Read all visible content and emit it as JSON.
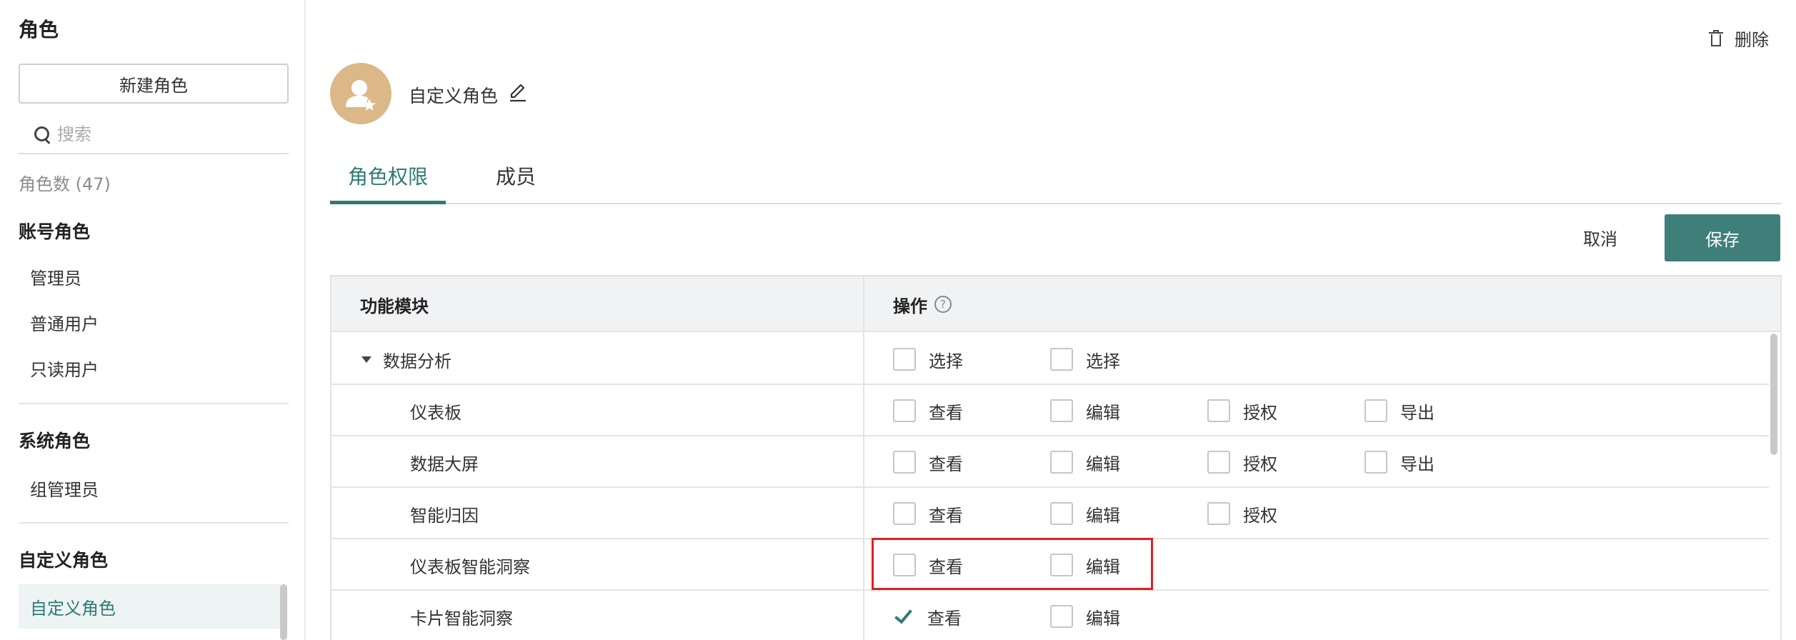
{
  "sidebar": {
    "title": "角色",
    "new_role_button": "新建角色",
    "search_placeholder": "搜索",
    "role_count": "角色数 (47)",
    "groups": [
      {
        "title": "账号角色",
        "items": [
          "管理员",
          "普通用户",
          "只读用户"
        ]
      },
      {
        "title": "系统角色",
        "items": [
          "组管理员"
        ]
      },
      {
        "title": "自定义角色",
        "items": [
          "自定义角色"
        ]
      }
    ],
    "active_item": "自定义角色"
  },
  "header": {
    "delete_label": "删除",
    "role_name": "自定义角色"
  },
  "tabs": [
    {
      "label": "角色权限",
      "active": true
    },
    {
      "label": "成员",
      "active": false
    }
  ],
  "actions": {
    "cancel_label": "取消",
    "save_label": "保存"
  },
  "table": {
    "columns": [
      "功能模块",
      "操作"
    ],
    "rows": [
      {
        "module": "数据分析",
        "expanded": true,
        "ops": [
          {
            "label": "选择",
            "checked": false
          },
          {
            "label": "选择",
            "checked": false
          }
        ]
      },
      {
        "module": "仪表板",
        "ops": [
          {
            "label": "查看",
            "checked": false
          },
          {
            "label": "编辑",
            "checked": false
          },
          {
            "label": "授权",
            "checked": false
          },
          {
            "label": "导出",
            "checked": false
          }
        ]
      },
      {
        "module": "数据大屏",
        "ops": [
          {
            "label": "查看",
            "checked": false
          },
          {
            "label": "编辑",
            "checked": false
          },
          {
            "label": "授权",
            "checked": false
          },
          {
            "label": "导出",
            "checked": false
          }
        ]
      },
      {
        "module": "智能归因",
        "ops": [
          {
            "label": "查看",
            "checked": false
          },
          {
            "label": "编辑",
            "checked": false
          },
          {
            "label": "授权",
            "checked": false
          }
        ]
      },
      {
        "module": "仪表板智能洞察",
        "highlighted": true,
        "ops": [
          {
            "label": "查看",
            "checked": false
          },
          {
            "label": "编辑",
            "checked": false
          }
        ]
      },
      {
        "module": "卡片智能洞察",
        "ops": [
          {
            "label": "查看",
            "checked": true
          },
          {
            "label": "编辑",
            "checked": false
          }
        ]
      }
    ]
  },
  "colors": {
    "accent": "#2f7a76",
    "save_button": "#3e7f7a",
    "avatar": "#dcb888",
    "highlight_border": "#e02020"
  }
}
